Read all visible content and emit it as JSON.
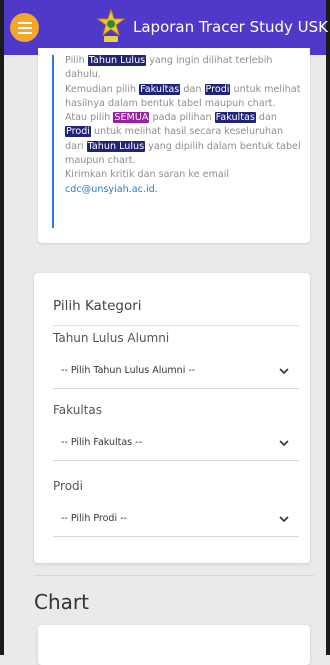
{
  "header": {
    "title": "Laporan Tracer Study USK",
    "menu_icon": "hamburger-icon",
    "logo_icon": "university-emblem-icon"
  },
  "info": {
    "line1_pre": "Pilih",
    "line1_hl": "Tahun Lulus",
    "line1_post": "yang ingin dilihat terlebih dahulu.",
    "line2_pre": "Kemudian pilih",
    "line2_hl1": "Fakultas",
    "line2_mid": "dan",
    "line2_hl2": "Prodi",
    "line2_post": "untuk melihat hasilnya dalam bentuk tabel maupun chart.",
    "line3_pre": "Atau pilih",
    "line3_hl1": "SEMUA",
    "line3_mid1": "pada pilihan",
    "line3_hl2": "Fakultas",
    "line3_mid2": "dan",
    "line3_hl3": "Prodi",
    "line3_mid3": "untuk melihat hasil secara keseluruhan dari",
    "line3_hl4": "Tahun Lulus",
    "line3_post": "yang dipilih dalam bentuk tabel maupun chart.",
    "line4": "Kirimkan kritik dan saran ke email",
    "email": "cdc@unsyiah.ac.id."
  },
  "filters": {
    "title": "Pilih Kategori",
    "year_label": "Tahun Lulus Alumni",
    "year_placeholder": "-- Pilih Tahun Lulus Alumni --",
    "faculty_label": "Fakultas",
    "faculty_placeholder": "-- Pilih Fakultas --",
    "prodi_label": "Prodi",
    "prodi_placeholder": "-- Pilih Prodi --"
  },
  "chart_section": {
    "title": "Chart"
  },
  "colors": {
    "header_bg": "#4f39c8",
    "menu_button": "#f6a52b",
    "highlight": "#20237a",
    "highlight_semua": "#9b1ea8",
    "link": "#2e78e0"
  }
}
